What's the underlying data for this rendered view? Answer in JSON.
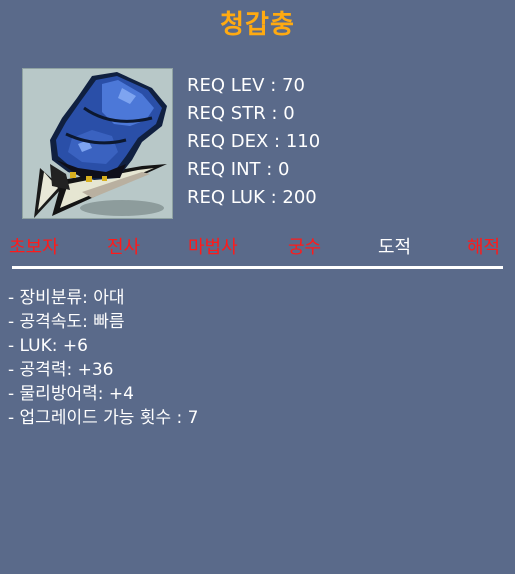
{
  "item": {
    "name": "청갑충",
    "icon": "blue-claw-item-icon",
    "name_color": "#ffaa11"
  },
  "requirements": [
    "REQ LEV : 70",
    "REQ STR : 0",
    "REQ DEX : 110",
    "REQ INT : 0",
    "REQ LUK : 200"
  ],
  "jobs": [
    {
      "label": "초보자",
      "allowed": false
    },
    {
      "label": "전사",
      "allowed": false
    },
    {
      "label": "마법사",
      "allowed": false
    },
    {
      "label": "궁수",
      "allowed": false
    },
    {
      "label": "도적",
      "allowed": true
    },
    {
      "label": "해적",
      "allowed": false
    }
  ],
  "stats": [
    "- 장비분류: 아대",
    "- 공격속도: 빠름",
    "- LUK: +6",
    "- 공격력: +36",
    "- 물리방어력: +4",
    "- 업그레이드 가능 횟수 : 7"
  ],
  "colors": {
    "background": "#5a6a8a",
    "disallowed_job": "#ff1a1a",
    "allowed_job": "#ffffff"
  }
}
